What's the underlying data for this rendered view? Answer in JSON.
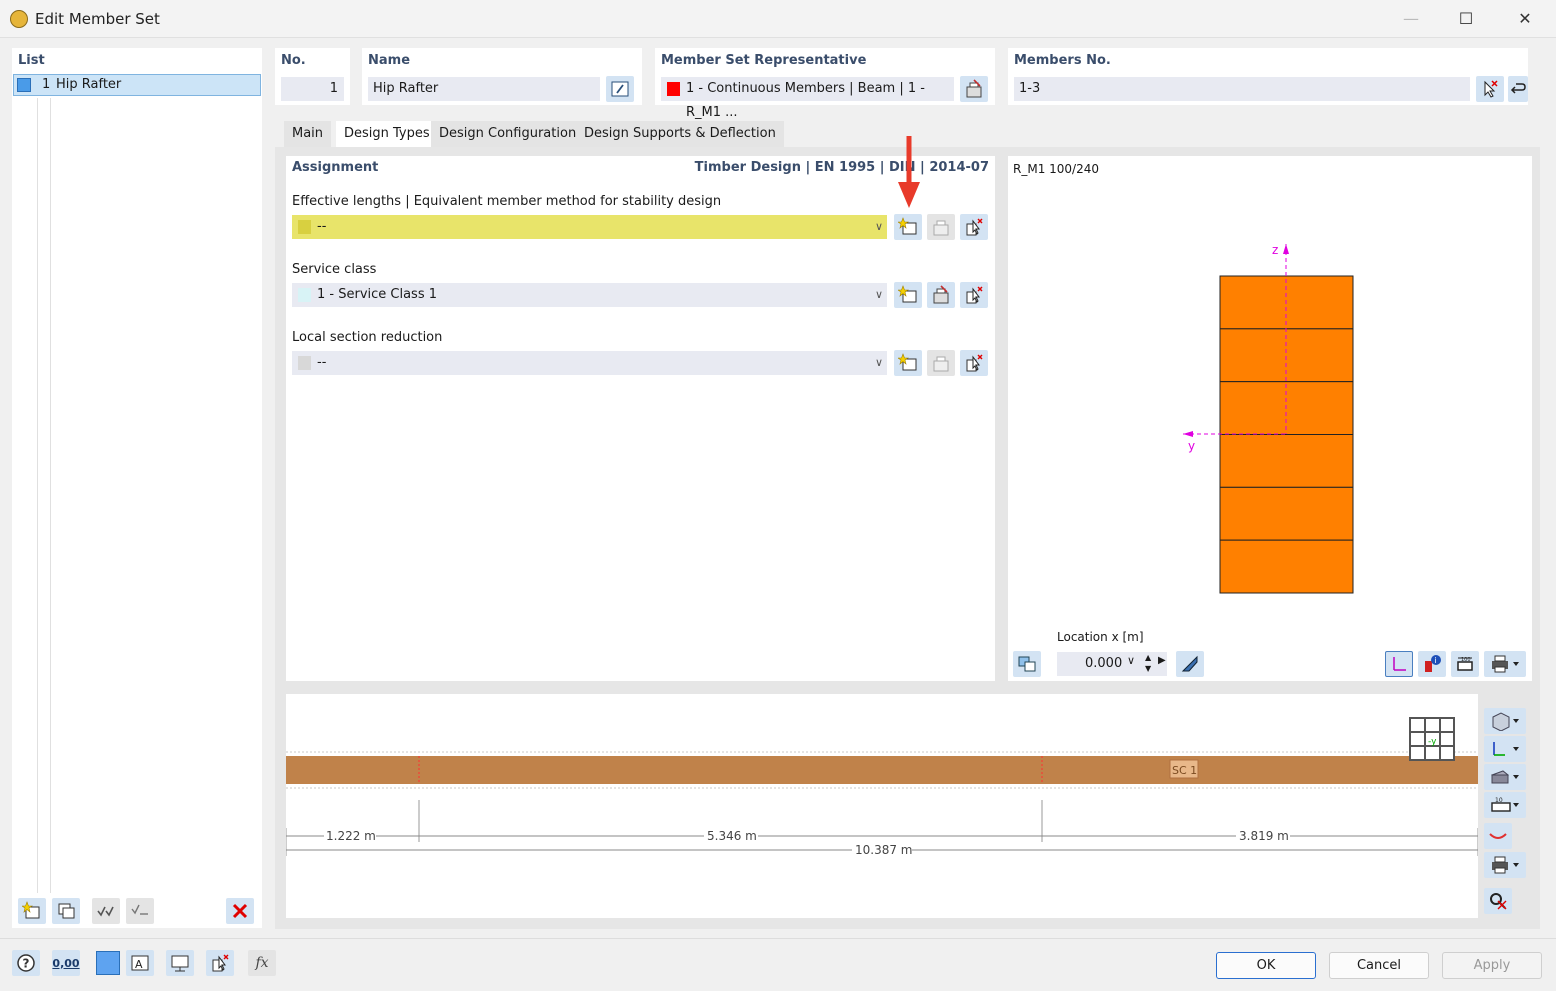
{
  "window": {
    "title": "Edit Member Set"
  },
  "list": {
    "header": "List",
    "items": [
      {
        "no": "1",
        "name": "Hip Rafter",
        "color": "#4a9be8"
      }
    ]
  },
  "no": {
    "label": "No.",
    "value": "1"
  },
  "name": {
    "label": "Name",
    "value": "Hip Rafter"
  },
  "representative": {
    "label": "Member Set Representative",
    "value": "1 - Continuous Members | Beam | 1 - R_M1 ...",
    "color": "#ff0000"
  },
  "members": {
    "label": "Members No.",
    "value": "1-3"
  },
  "tabs": [
    "Main",
    "Design Types",
    "Design Configurations",
    "Design Supports & Deflection"
  ],
  "active_tab": "Design Types",
  "assignment": {
    "title": "Assignment",
    "standard": "Timber Design | EN 1995 | DIN | 2014-07",
    "effective_lengths": {
      "label": "Effective lengths | Equivalent member method for stability design",
      "value": "--",
      "color": "#e8e46a"
    },
    "service_class": {
      "label": "Service class",
      "value": "1 - Service Class 1",
      "color": "#d8f3f6"
    },
    "local_section_reduction": {
      "label": "Local section reduction",
      "value": "--",
      "color": "#d8d8d8"
    }
  },
  "section_preview": {
    "title": "R_M1 100/240",
    "axis_z": "z",
    "axis_y": "y",
    "fill_color": "#ff8000",
    "lamella_count": 6,
    "location_label": "Location x [m]",
    "location_value": "0.000"
  },
  "member_view": {
    "band_label": "SC 1",
    "band_color": "#c0824a",
    "dimensions": [
      "1.222 m",
      "5.346 m",
      "3.819 m"
    ],
    "total": "10.387 m"
  },
  "footer": {
    "ok": "OK",
    "cancel": "Cancel",
    "apply": "Apply",
    "units_badge": "0,00"
  }
}
